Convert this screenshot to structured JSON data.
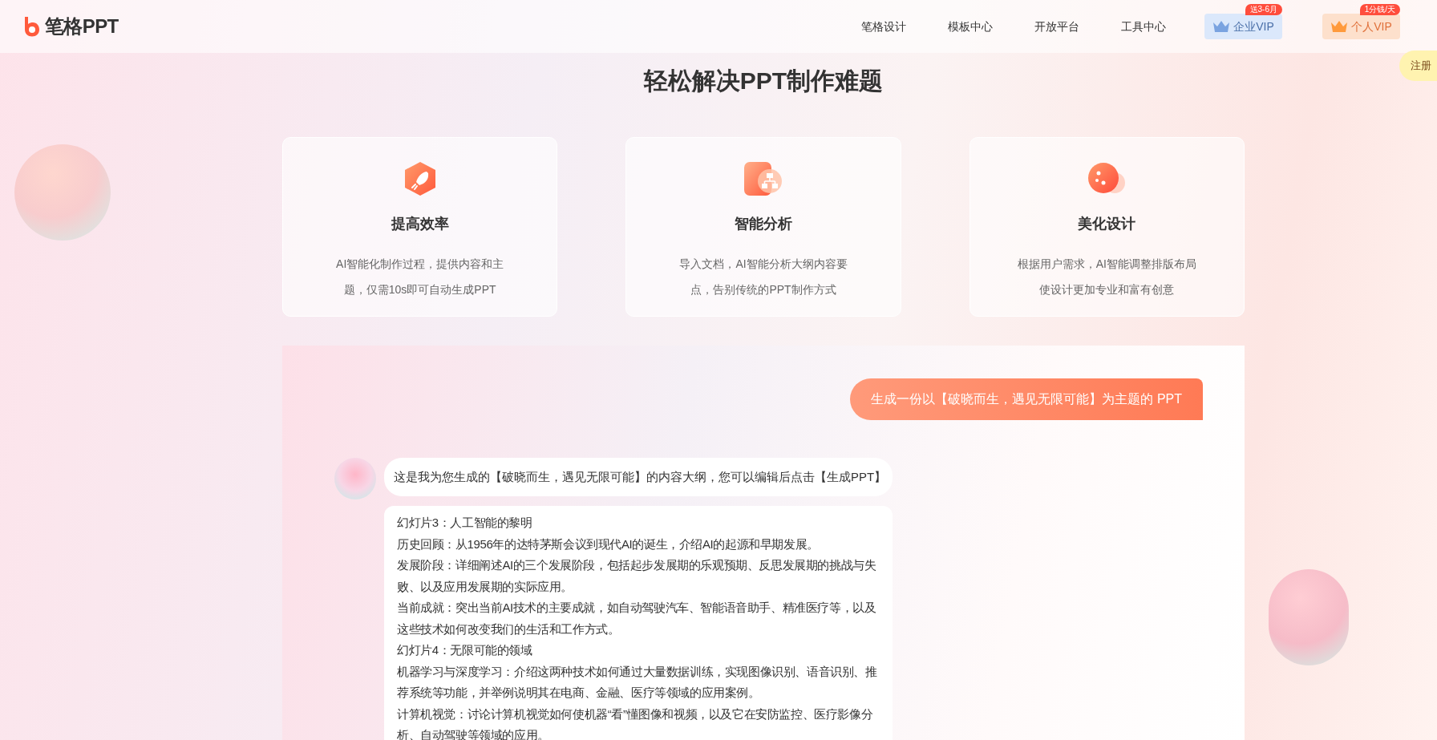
{
  "header": {
    "logo": "笔格PPT",
    "nav": [
      "笔格设计",
      "模板中心",
      "开放平台",
      "工具中心"
    ],
    "vip": [
      {
        "kind": "enterprise",
        "label": "企业VIP",
        "badge": "送3-6月"
      },
      {
        "kind": "personal",
        "label": "个人VIP",
        "badge": "1分钱/天"
      }
    ],
    "side_tab": "注册"
  },
  "title": "轻松解决PPT制作难题",
  "features": [
    {
      "kind": "rocket",
      "title": "提高效率",
      "description_lines": [
        "AI智能化制作过程，提供内容和主",
        "题，仅需10s即可自动生成PPT"
      ]
    },
    {
      "kind": "flow",
      "title": "智能分析",
      "description_lines": [
        "导入文档，AI智能分析大纲内容要",
        "点，告别传统的PPT制作方式"
      ]
    },
    {
      "kind": "palette",
      "title": "美化设计",
      "description_lines": [
        "根据用户需求，AI智能调整排版布局",
        "使设计更加专业和富有创意"
      ]
    }
  ],
  "chat": {
    "user_message": "生成一份以【破晓而生，遇见无限可能】为主题的 PPT",
    "assistant_message": "这是我为您生成的【破晓而生，遇见无限可能】的内容大纲，您可以编辑后点击【生成PPT】",
    "outline": [
      "幻灯片3：人工智能的黎明",
      "历史回顾：从1956年的达特茅斯会议到现代AI的诞生，介绍AI的起源和早期发展。",
      "发展阶段：详细阐述AI的三个发展阶段，包括起步发展期的乐观预期、反思发展期的挑战与失败、以及应用发展期的实际应用。",
      "当前成就：突出当前AI技术的主要成就，如自动驾驶汽车、智能语音助手、精准医疗等，以及这些技术如何改变我们的生活和工作方式。",
      "幻灯片4：无限可能的领域",
      "机器学习与深度学习：介绍这两种技术如何通过大量数据训练，实现图像识别、语音识别、推荐系统等功能，并举例说明其在电商、金融、医疗等领域的应用案例。",
      "计算机视觉：讨论计算机视觉如何使机器“看”懂图像和视频，以及它在安防监控、医疗影像分析、自动驾驶等领域的应用。"
    ]
  }
}
